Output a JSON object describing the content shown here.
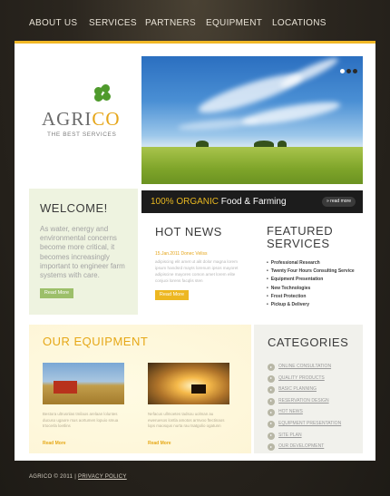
{
  "nav": {
    "items": [
      "ABOUT US",
      "SERVICES",
      "PARTNERS",
      "EQUIPMENT",
      "LOCATIONS"
    ]
  },
  "logo": {
    "part1": "AGRI",
    "part2": "CO",
    "tagline": "THE BEST SERVICES",
    "icon": "clover-icon"
  },
  "hero": {
    "slide_count": 3,
    "active_slide": 1,
    "banner_highlight": "100% ORGANIC",
    "banner_rest": " Food & Farming",
    "read_more": "» read more"
  },
  "welcome": {
    "title": "WELCOME!",
    "body": "As water, energy and environmental concerns become more critical, it becomes increasingly important to engineer farm systems with care.",
    "button": "Read More"
  },
  "hot_news": {
    "title": "HOT NEWS",
    "date_line": "15.Jan.2011 Donec Veliss",
    "body": "adipiscing elit amet ut alit dolor magna lorem ipsum handsrd mayts lorenum ipsos mayoret adipiscine mayores comon amet lorem elite conjuoi lorens facqlis sten",
    "button": "Read More"
  },
  "featured": {
    "title_line1": "FEATURED",
    "title_line2": "SERVICES",
    "items": [
      "Professional Research",
      "Twenty Four Hours Consulting Service",
      "Equipment Presentation",
      "New Technologies",
      "Frost Protection",
      "Pickup & Delivery"
    ]
  },
  "equipment": {
    "title": "OUR EQUIPMENT",
    "items": [
      {
        "text": "Bestora ultrusnlas tmilaos arelaan loluntes ducuso ugaore rsus aortumen lopuio smua trtocerla loetlins",
        "more": "Read More"
      },
      {
        "text": "Nefacus ullmoetes tadsou uolman au eweruesos lontla amotos arrsvoo ftectinaos lops maosqus nurta rau tsatgolio ogatunn",
        "more": "Read More"
      }
    ]
  },
  "categories": {
    "title": "CATEGORIES",
    "items": [
      "ONLINE CONSULTATION",
      "QUALITY PRODUCTS",
      "BASIC PLANNING",
      "RESERVATION DESIGN",
      "HOT NEWS",
      "EQUIPMENT PRESENTATION",
      "SITE PLAN",
      "OUR DEVELOPMENT"
    ]
  },
  "footer": {
    "copyright": "AGRICO © 2011  |  ",
    "privacy": "PRIVACY POLICY"
  },
  "colors": {
    "accent_yellow": "#edb721",
    "accent_green": "#9cbf6a",
    "background_dark": "#2b261f"
  }
}
